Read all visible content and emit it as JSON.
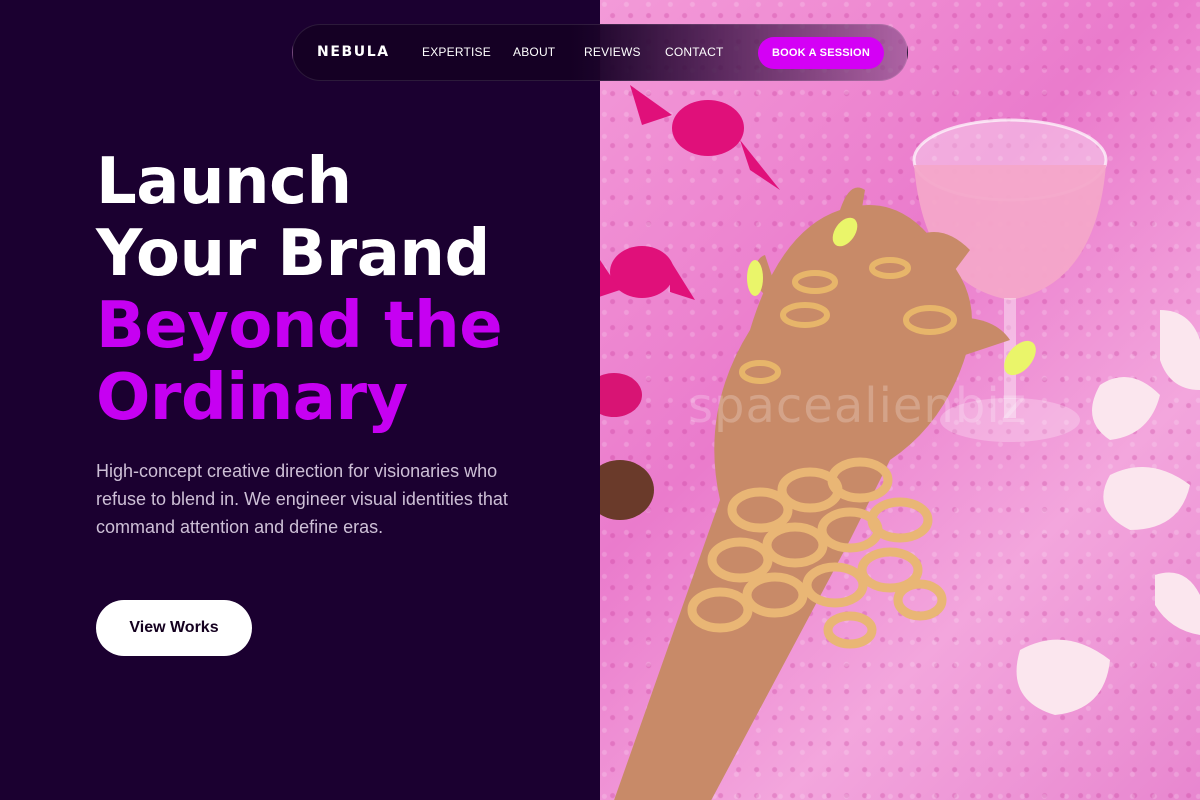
{
  "nav": {
    "brand": "NEBULA",
    "links": [
      "EXPERTISE",
      "ABOUT",
      "REVIEWS",
      "CONTACT"
    ],
    "cta": "BOOK A SESSION"
  },
  "hero": {
    "title_line1": "Launch",
    "title_line2": "Your Brand",
    "title_line3": "Beyond the",
    "title_line4": "Ordinary",
    "description": "High-concept creative direction for visionaries who refuse to blend in. We engineer visual identities that command attention and define eras.",
    "button": "View Works"
  },
  "photo": {
    "watermark": "spacealienbiz"
  },
  "colors": {
    "background": "#1b0030",
    "accent": "#c600f2",
    "cta": "#d400f5",
    "text_light": "#cdbfd6"
  }
}
